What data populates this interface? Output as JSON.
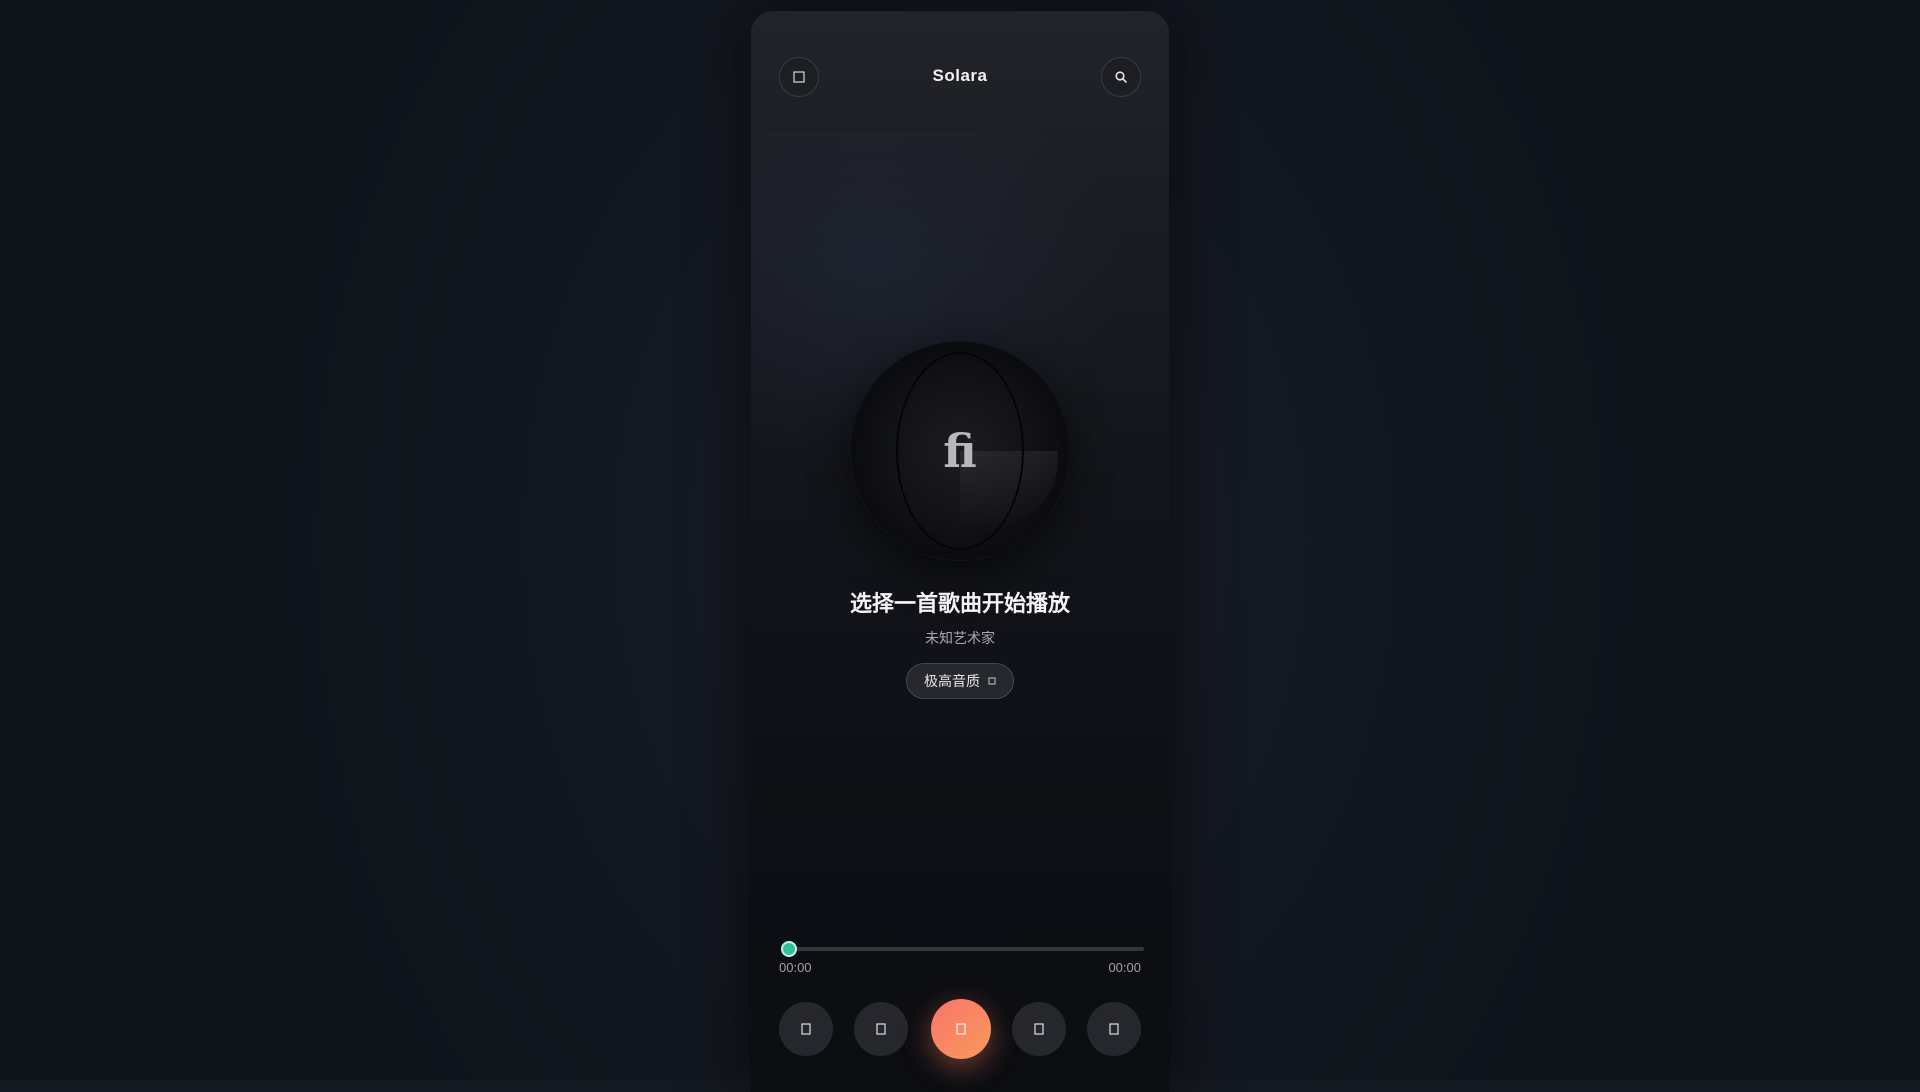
{
  "app": {
    "title": "Solara"
  },
  "header": {
    "left_icon": "menu-icon",
    "right_icon": "search-icon"
  },
  "disc": {
    "glyph": "ﬁ"
  },
  "now_playing": {
    "title": "选择一首歌曲开始播放",
    "artist": "未知艺术家",
    "quality_label": "极高音质",
    "quality_icon": "chevron-down-icon"
  },
  "progress": {
    "elapsed": "00:00",
    "duration": "00:00",
    "fraction": 0.0
  },
  "controls": [
    {
      "name": "playlist-button",
      "icon": "list-icon"
    },
    {
      "name": "previous-button",
      "icon": "skip-back-icon"
    },
    {
      "name": "play-button",
      "icon": "play-icon"
    },
    {
      "name": "next-button",
      "icon": "skip-forward-icon"
    },
    {
      "name": "volume-button",
      "icon": "volume-icon"
    }
  ],
  "colors": {
    "accent_start": "#f8746a",
    "accent_end": "#fa9a5c",
    "progress_thumb": "#2dc39a",
    "background": "#141820"
  }
}
